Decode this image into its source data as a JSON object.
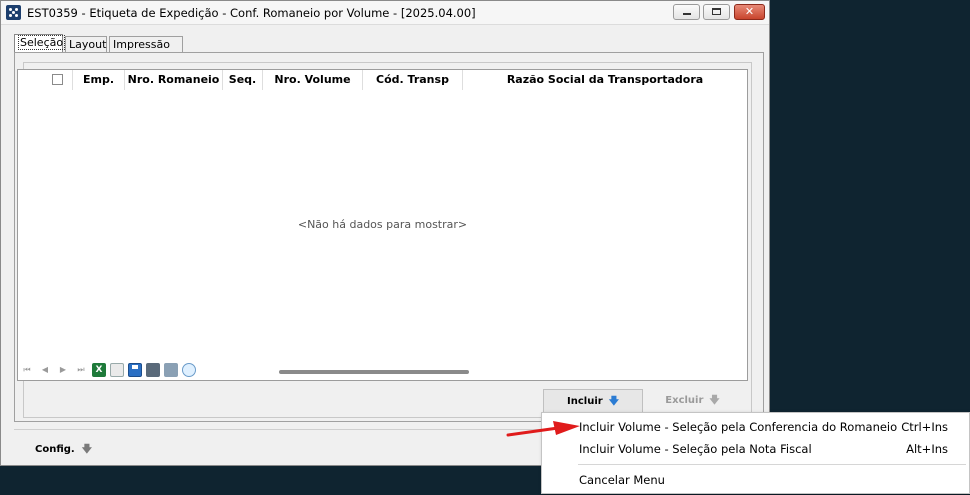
{
  "window": {
    "title": "EST0359 - Etiqueta de Expedição - Conf. Romaneio por Volume - [2025.04.00]",
    "controls": {
      "minimize": "minimize-icon",
      "maximize": "maximize-icon",
      "close": "✕"
    }
  },
  "tabs": [
    {
      "label": "Seleção",
      "active": true
    },
    {
      "label": "Layout",
      "active": false
    },
    {
      "label": "Impressão",
      "active": false
    }
  ],
  "grid": {
    "columns": [
      "Emp.",
      "Nro. Romaneio",
      "Seq.",
      "Nro. Volume",
      "Cód. Transp",
      "Razão Social da Transportadora"
    ],
    "empty_message": "<Não há dados para mostrar>",
    "navigator": {
      "first": "⏮",
      "prev": "◀",
      "next": "▶",
      "last": "⏭",
      "excel_label": "X"
    }
  },
  "buttons": {
    "incluir": "Incluir",
    "excluir": "Excluir",
    "arrow": "🡇"
  },
  "config": {
    "label": "Config."
  },
  "context_menu": {
    "items": [
      {
        "label": "Incluir Volume - Seleção pela Conferencia do Romaneio",
        "shortcut": "Ctrl+Ins"
      },
      {
        "label": "Incluir Volume - Seleção pela Nota Fiscal",
        "shortcut": "Alt+Ins"
      },
      {
        "label": "Cancelar Menu",
        "shortcut": ""
      }
    ]
  },
  "colors": {
    "desktop": "#0f2430",
    "accent_blue": "#2b7cd3",
    "annotation_red": "#e01b1b"
  }
}
